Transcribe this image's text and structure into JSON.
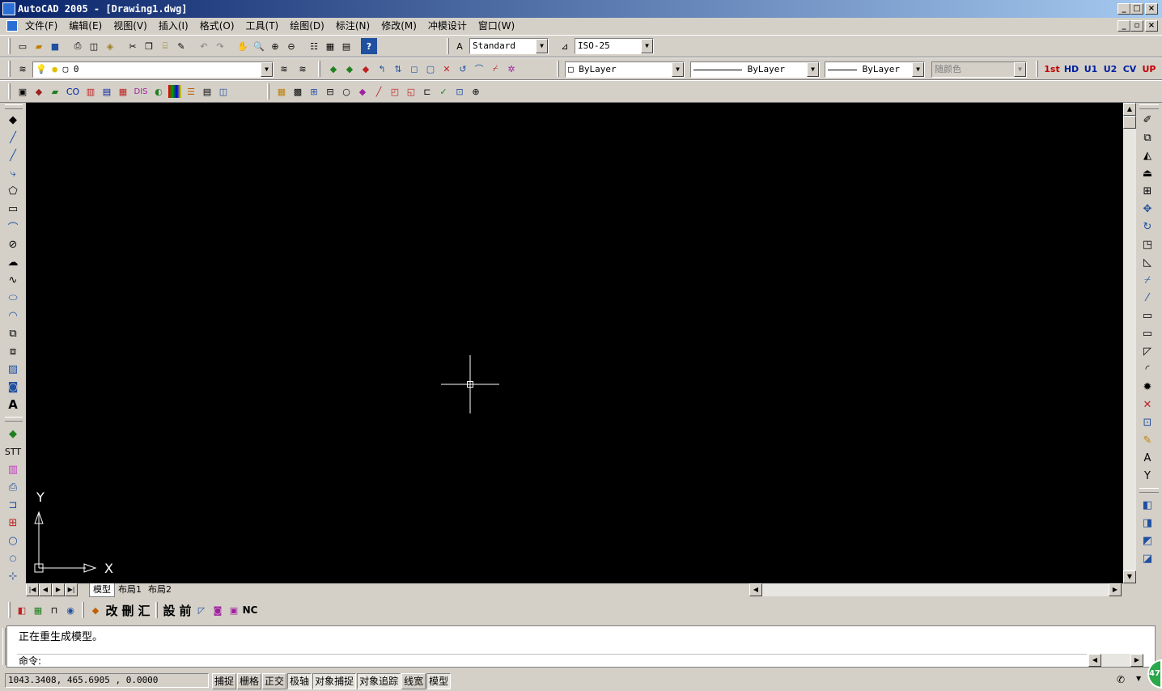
{
  "window": {
    "title": "AutoCAD 2005 - [Drawing1.dwg]"
  },
  "menu": [
    "文件(F)",
    "编辑(E)",
    "视图(V)",
    "插入(I)",
    "格式(O)",
    "工具(T)",
    "绘图(D)",
    "标注(N)",
    "修改(M)",
    "冲模设计",
    "窗口(W)"
  ],
  "styles": {
    "text_style": "Standard",
    "dim_style": "ISO-25"
  },
  "layer": {
    "current": "0"
  },
  "properties": {
    "color": "ByLayer",
    "linetype": "ByLayer",
    "lineweight": "ByLayer",
    "plotstyle": "随颜色"
  },
  "custom_toolbar_right": [
    "1st",
    "HD",
    "U1",
    "U2",
    "CV",
    "UP"
  ],
  "toolbar3_labels": [
    "CO",
    "DIS"
  ],
  "left_toolbar_text": {
    "text_icon": "A",
    "stt": "STT"
  },
  "ucs": {
    "x_label": "X",
    "y_label": "Y"
  },
  "layout_tabs": [
    "模型",
    "布局1",
    "布局2"
  ],
  "bottom_toolbar_chars": [
    "改",
    "刪",
    "汇",
    "設",
    "前",
    "NC"
  ],
  "command": {
    "history": "正在重生成模型。",
    "prompt": "命令:"
  },
  "status": {
    "coordinates": "1043.3408,  465.6905 ,  0.0000",
    "toggles": [
      {
        "label": "捕捉",
        "on": false
      },
      {
        "label": "栅格",
        "on": false
      },
      {
        "label": "正交",
        "on": false
      },
      {
        "label": "极轴",
        "on": true
      },
      {
        "label": "对象捕捉",
        "on": true
      },
      {
        "label": "对象追踪",
        "on": true
      },
      {
        "label": "线宽",
        "on": false
      },
      {
        "label": "模型",
        "on": true
      }
    ],
    "badge": "47"
  },
  "colors": {
    "canvas_bg": "#000000",
    "title_gradient_start": "#0a246a",
    "title_gradient_end": "#a6caf0",
    "chrome": "#d4d0c8",
    "crosshair": "#ffffff"
  }
}
